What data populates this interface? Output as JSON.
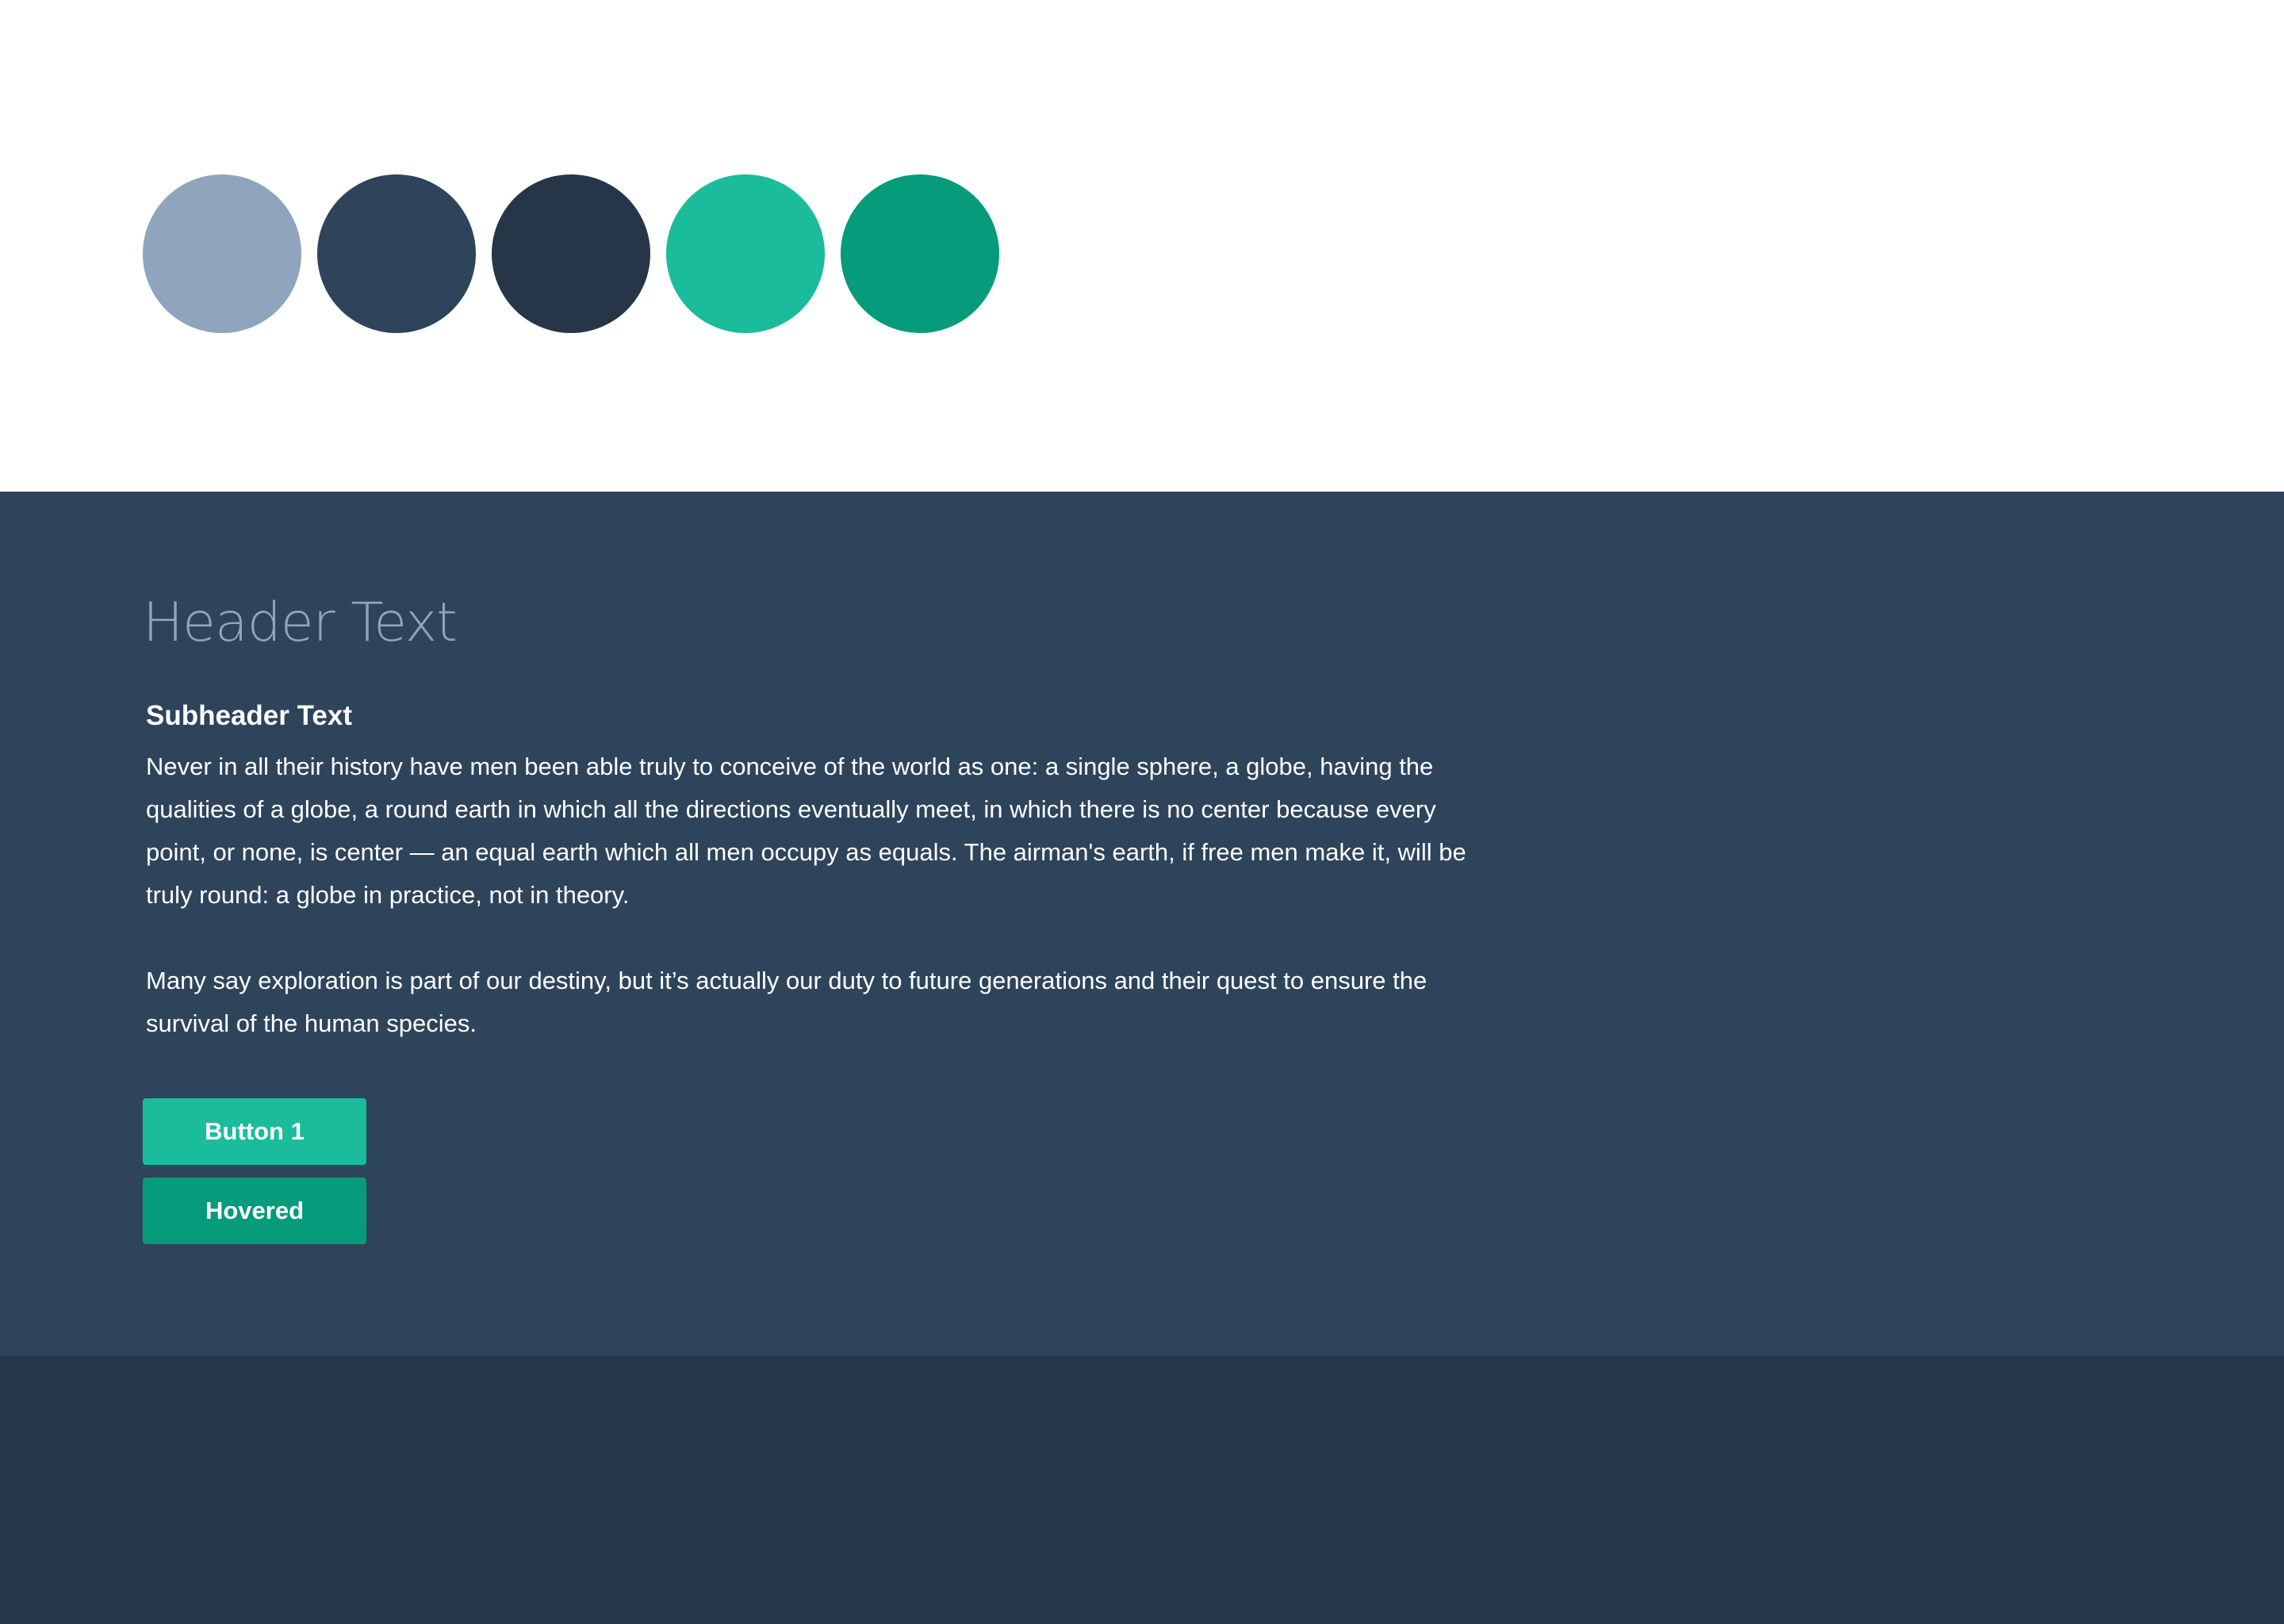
{
  "palette": {
    "swatches": [
      {
        "name": "light-slate",
        "color": "#8ea5bd"
      },
      {
        "name": "navy",
        "color": "#2e445b"
      },
      {
        "name": "dark-navy",
        "color": "#263547"
      },
      {
        "name": "teal",
        "color": "#1abc9c"
      },
      {
        "name": "dark-teal",
        "color": "#059b7b"
      }
    ]
  },
  "content": {
    "header": "Header Text",
    "subheader": "Subheader Text",
    "paragraphs": [
      "Never in all their history have men been able truly to conceive of the world as one: a single sphere, a globe, having the qualities of a globe, a round earth in which all the directions eventually meet, in which there is no center because every point, or none, is center — an equal earth which all men occupy as equals. The airman's earth, if free men make it, will be truly round: a globe in practice, not in theory.",
      "Many say exploration is part of our destiny, but it’s actually our duty to future generations and their quest to ensure the survival of the human species."
    ],
    "buttons": {
      "primary_label": "Button 1",
      "hovered_label": "Hovered"
    }
  },
  "colors": {
    "white": "#ffffff",
    "navy_background": "#2e445b",
    "footer_background": "#263547",
    "header_text": "#8ea5bd",
    "accent": "#1abc9c",
    "accent_hover": "#059b7b"
  }
}
